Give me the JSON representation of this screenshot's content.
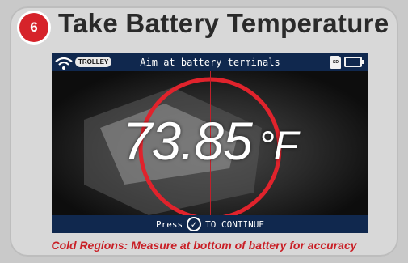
{
  "step": {
    "number": "6",
    "title": "Take Battery Temperature"
  },
  "device_screen": {
    "mode_badge": "TROLLEY",
    "instruction": "Aim at battery terminals",
    "sd_label": "SD",
    "reading_value": "73.85",
    "reading_unit": "°F",
    "footer_prefix": "Press",
    "footer_suffix": "TO CONTINUE",
    "colors": {
      "status_bar": "#10284e",
      "target_circle": "#e0232c"
    }
  },
  "caption": "Cold Regions: Measure at bottom of battery for accuracy",
  "icons": [
    "wifi-icon",
    "sd-card-icon",
    "battery-icon",
    "checkmark-icon"
  ]
}
